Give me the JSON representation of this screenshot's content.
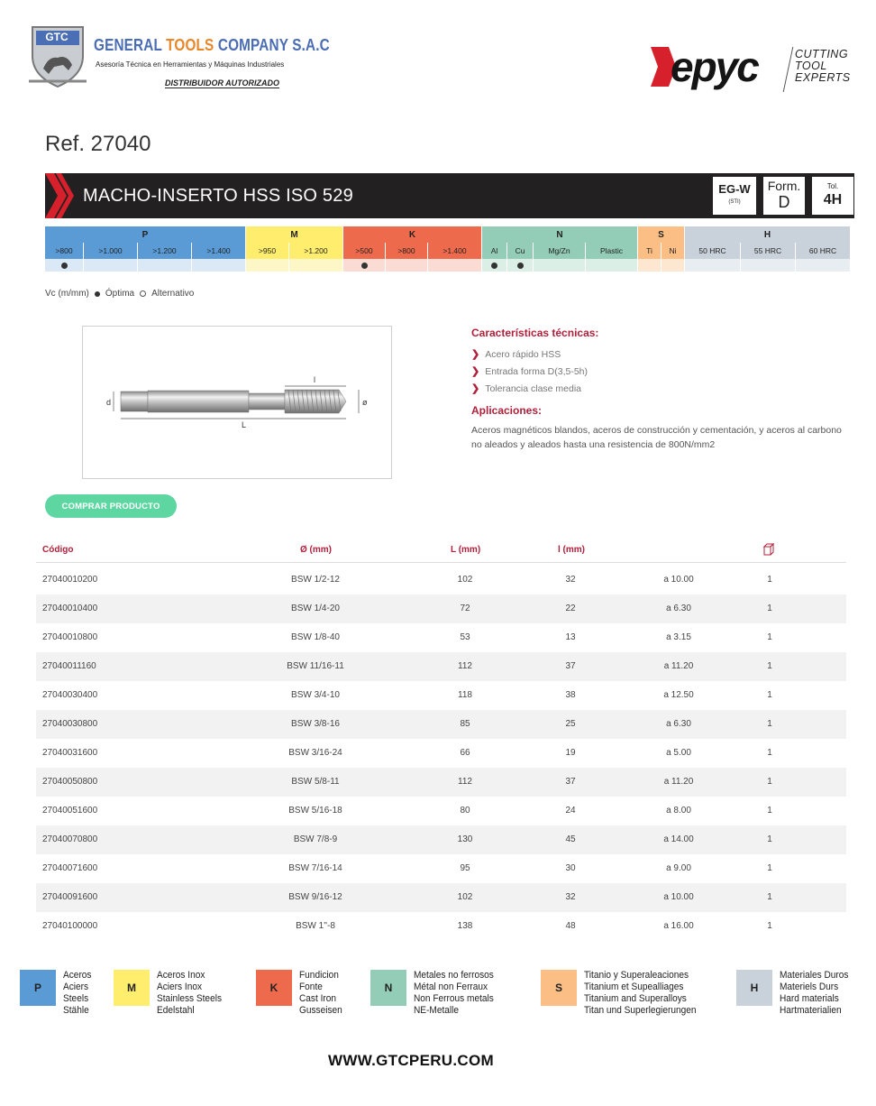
{
  "header": {
    "gtc_logo_text": "GTC",
    "company_name_a": "GENERAL ",
    "company_name_b": "TOOLS",
    "company_name_c": " COMPANY S.A.C",
    "company_subtitle": "Asesoría Técnica en Herramientas y Máquinas Industriales",
    "distributor": "DISTRIBUIDOR AUTORIZADO",
    "brand": "Hepyc",
    "brand_tagline": [
      "CUTTING",
      "TOOL",
      "EXPERTS"
    ]
  },
  "ref": "Ref. 27040",
  "title": {
    "text": "MACHO-INSERTO HSS ISO 529",
    "egw": "EG-W",
    "egw_sub": "(STI)",
    "form_label": "Form.",
    "form_value": "D",
    "tol_label": "Tol.",
    "tol_value": "4H"
  },
  "colors": {
    "P": "#5b9bd5",
    "P_light": "#dbe9f6",
    "M": "#ffee6e",
    "M_light": "#fdf7c7",
    "K": "#ee6a4c",
    "K_light": "#fbdcd4",
    "N": "#94cdb7",
    "N_light": "#dcefe7",
    "S": "#fbbf86",
    "S_light": "#fde7d1",
    "H": "#c9d2db",
    "H_light": "#e8edf1",
    "accent_red": "#b0203a",
    "button_green": "#5dd6a1"
  },
  "materials": {
    "groups": [
      {
        "code": "P",
        "span": 4
      },
      {
        "code": "M",
        "span": 2
      },
      {
        "code": "K",
        "span": 3
      },
      {
        "code": "N",
        "span": 4
      },
      {
        "code": "S",
        "span": 2
      },
      {
        "code": "H",
        "span": 3
      }
    ],
    "subs": [
      {
        "g": "P",
        "label": ">800",
        "w": 43,
        "dot": true
      },
      {
        "g": "P",
        "label": ">1.000",
        "w": 60,
        "dot": false
      },
      {
        "g": "P",
        "label": ">1.200",
        "w": 60,
        "dot": false
      },
      {
        "g": "P",
        "label": ">1.400",
        "w": 60,
        "dot": false
      },
      {
        "g": "M",
        "label": ">950",
        "w": 48,
        "dot": false
      },
      {
        "g": "M",
        "label": ">1.200",
        "w": 60,
        "dot": false
      },
      {
        "g": "K",
        "label": ">500",
        "w": 47,
        "dot": true
      },
      {
        "g": "K",
        "label": ">800",
        "w": 47,
        "dot": false
      },
      {
        "g": "K",
        "label": ">1.400",
        "w": 60,
        "dot": false
      },
      {
        "g": "N",
        "label": "Al",
        "w": 28,
        "dot": true
      },
      {
        "g": "N",
        "label": "Cu",
        "w": 29,
        "dot": true
      },
      {
        "g": "N",
        "label": "Mg/Zn",
        "w": 58,
        "dot": false
      },
      {
        "g": "N",
        "label": "Plastic",
        "w": 58,
        "dot": false
      },
      {
        "g": "S",
        "label": "Ti",
        "w": 26,
        "dot": false
      },
      {
        "g": "S",
        "label": "Ni",
        "w": 26,
        "dot": false
      },
      {
        "g": "H",
        "label": "50 HRC",
        "w": 62,
        "dot": false
      },
      {
        "g": "H",
        "label": "55 HRC",
        "w": 61,
        "dot": false
      },
      {
        "g": "H",
        "label": "60 HRC",
        "w": 61,
        "dot": false
      }
    ]
  },
  "vc_legend": {
    "label": "Vc (m/mm)",
    "optimal": "Óptima",
    "alternative": "Alternativo"
  },
  "drawing_labels": {
    "d": "d",
    "l": "l",
    "L": "L",
    "diam": "ø"
  },
  "characteristics": {
    "title": "Características técnicas:",
    "items": [
      "Acero rápido HSS",
      "Entrada forma D(3,5-5h)",
      "Tolerancia clase media"
    ]
  },
  "applications": {
    "title": "Aplicaciones:",
    "text": "Aceros magnéticos blandos, aceros de construcción y cementación, y aceros al carbono no aleados y aleados hasta una resistencia de 800N/mm2"
  },
  "buy_button": "COMPRAR PRODUCTO",
  "table": {
    "headers": {
      "code": "Código",
      "diam": "Ø (mm)",
      "L": "L (mm)",
      "l": "l (mm)"
    },
    "rows": [
      [
        "27040010200",
        "BSW 1/2-12",
        "102",
        "32",
        "a 10.00",
        "1"
      ],
      [
        "27040010400",
        "BSW 1/4-20",
        "72",
        "22",
        "a 6.30",
        "1"
      ],
      [
        "27040010800",
        "BSW 1/8-40",
        "53",
        "13",
        "a 3.15",
        "1"
      ],
      [
        "27040011160",
        "BSW 11/16-11",
        "112",
        "37",
        "a 11.20",
        "1"
      ],
      [
        "27040030400",
        "BSW 3/4-10",
        "118",
        "38",
        "a 12.50",
        "1"
      ],
      [
        "27040030800",
        "BSW 3/8-16",
        "85",
        "25",
        "a 6.30",
        "1"
      ],
      [
        "27040031600",
        "BSW 3/16-24",
        "66",
        "19",
        "a 5.00",
        "1"
      ],
      [
        "27040050800",
        "BSW 5/8-11",
        "112",
        "37",
        "a 11.20",
        "1"
      ],
      [
        "27040051600",
        "BSW 5/16-18",
        "80",
        "24",
        "a 8.00",
        "1"
      ],
      [
        "27040070800",
        "BSW 7/8-9",
        "130",
        "45",
        "a 14.00",
        "1"
      ],
      [
        "27040071600",
        "BSW 7/16-14",
        "95",
        "30",
        "a 9.00",
        "1"
      ],
      [
        "27040091600",
        "BSW 9/16-12",
        "102",
        "32",
        "a 10.00",
        "1"
      ],
      [
        "27040100000",
        "BSW 1''-8",
        "138",
        "48",
        "a 16.00",
        "1"
      ]
    ]
  },
  "bottom_legend": [
    {
      "code": "P",
      "lines": [
        "Aceros",
        "Aciers",
        "Steels",
        "Stähle"
      ]
    },
    {
      "code": "M",
      "lines": [
        "Aceros Inox",
        "Aciers Inox",
        "Stainless Steels",
        "Edelstahl"
      ]
    },
    {
      "code": "K",
      "lines": [
        "Fundicion",
        "Fonte",
        "Cast Iron",
        "Gusseisen"
      ]
    },
    {
      "code": "N",
      "lines": [
        "Metales no ferrosos",
        "Métal non Ferraux",
        "Non Ferrous metals",
        "NE-Metalle"
      ]
    },
    {
      "code": "S",
      "lines": [
        "Titanio y Superaleaciones",
        "Titanium et Supealliages",
        "Titanium and Superalloys",
        "Titan und Superlegierungen"
      ]
    },
    {
      "code": "H",
      "lines": [
        "Materiales Duros",
        "Materiels Durs",
        "Hard materials",
        "Hartmaterialien"
      ]
    }
  ],
  "footer": "WWW.GTCPERU.COM"
}
